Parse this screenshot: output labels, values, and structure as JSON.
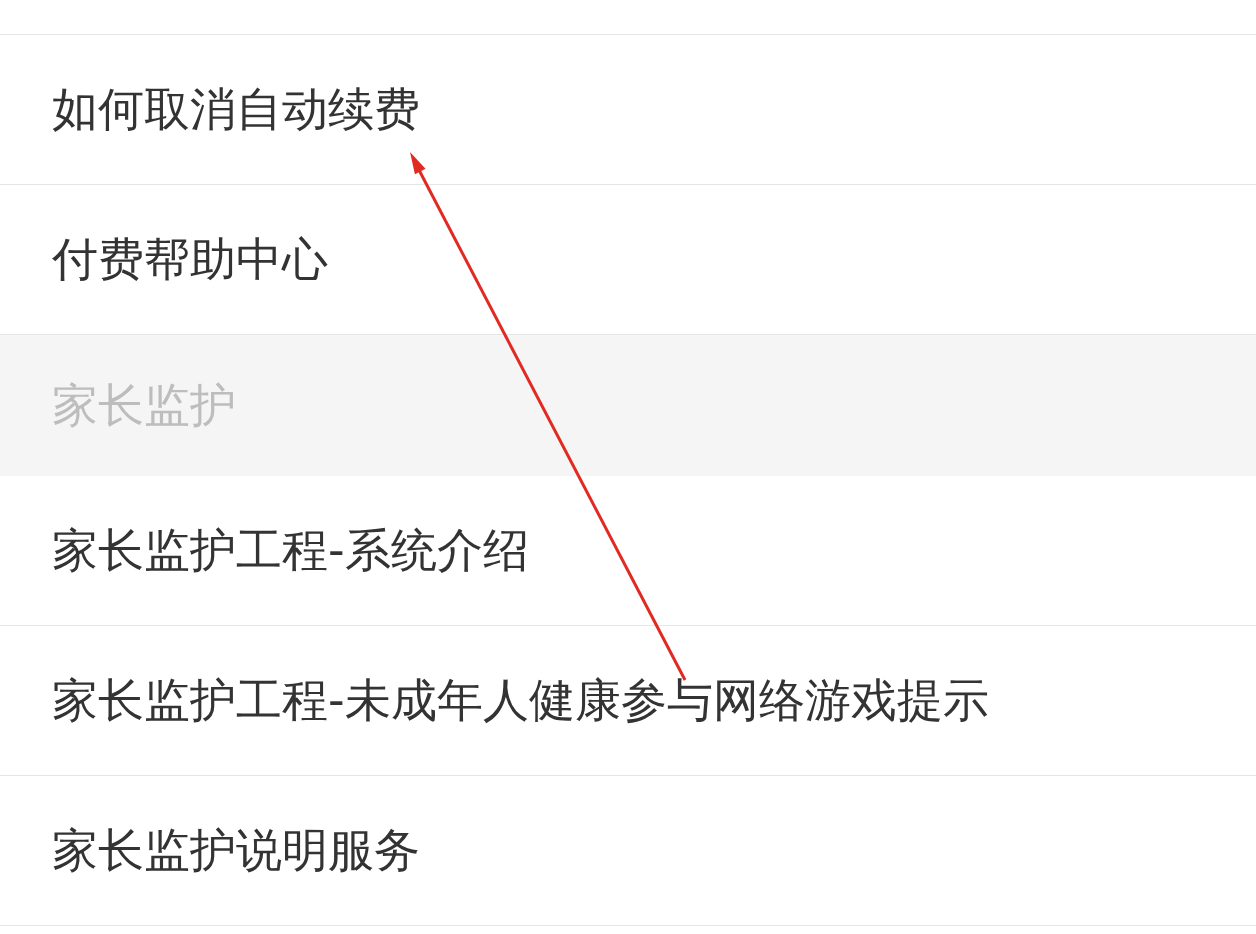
{
  "rows": [
    {
      "kind": "item",
      "label": "如何取消自动续费"
    },
    {
      "kind": "item",
      "label": "付费帮助中心"
    },
    {
      "kind": "header",
      "label": "家长监护"
    },
    {
      "kind": "item",
      "label": "家长监护工程-系统介绍"
    },
    {
      "kind": "item",
      "label": "家长监护工程-未成年人健康参与网络游戏提示"
    },
    {
      "kind": "item",
      "label": "家长监护说明服务"
    }
  ]
}
